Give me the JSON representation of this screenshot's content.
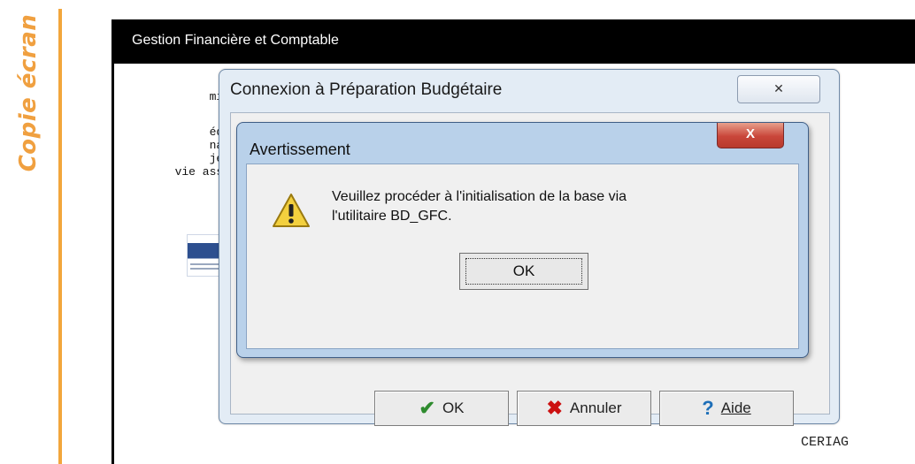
{
  "side_label": "Copie écran",
  "window": {
    "title": "Gestion Financière et Comptable",
    "left_text": {
      "line1": "min",
      "line2": "édu",
      "line3": "nat",
      "line4": "jeu",
      "line5": "vie asso"
    },
    "footer": "CERIAG"
  },
  "connexion_dialog": {
    "title": "Connexion à Préparation Budgétaire",
    "close_label": "✕",
    "buttons": {
      "ok": "OK",
      "annuler": "Annuler",
      "aide": "Aide"
    }
  },
  "warning_dialog": {
    "title": "Avertissement",
    "close_label": "X",
    "message_line1": "Veuillez procéder à l'initialisation de la base via",
    "message_line2": "l'utilitaire BD_GFC.",
    "ok_label": "OK"
  },
  "colors": {
    "side_accent": "#f2a63c",
    "titlebar": "#000000",
    "warn_close": "#c9463a"
  }
}
